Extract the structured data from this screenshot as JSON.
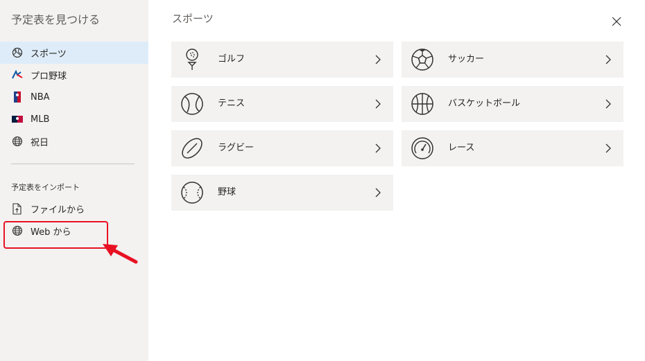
{
  "sidebar": {
    "title": "予定表を見つける",
    "items": [
      {
        "label": "スポーツ",
        "icon": "sports-ball-icon"
      },
      {
        "label": "プロ野球",
        "icon": "npb-logo-icon"
      },
      {
        "label": "NBA",
        "icon": "nba-logo-icon"
      },
      {
        "label": "MLB",
        "icon": "mlb-logo-icon"
      },
      {
        "label": "祝日",
        "icon": "globe-icon"
      }
    ],
    "import_section_label": "予定表をインポート",
    "import_items": [
      {
        "label": "ファイルから",
        "icon": "file-upload-icon"
      },
      {
        "label": "Web から",
        "icon": "globe-icon"
      }
    ]
  },
  "main": {
    "title": "スポーツ",
    "tiles": [
      {
        "label": "ゴルフ",
        "icon": "golf-icon"
      },
      {
        "label": "サッカー",
        "icon": "soccer-icon"
      },
      {
        "label": "テニス",
        "icon": "tennis-icon"
      },
      {
        "label": "バスケットボール",
        "icon": "basketball-icon"
      },
      {
        "label": "ラグビー",
        "icon": "rugby-icon"
      },
      {
        "label": "レース",
        "icon": "racing-gauge-icon"
      },
      {
        "label": "野球",
        "icon": "baseball-icon"
      }
    ]
  },
  "colors": {
    "sidebar_bg": "#f3f2f1",
    "active_bg": "#deecf9",
    "tile_bg": "#f3f2f1",
    "annotation_red": "#e81123"
  }
}
